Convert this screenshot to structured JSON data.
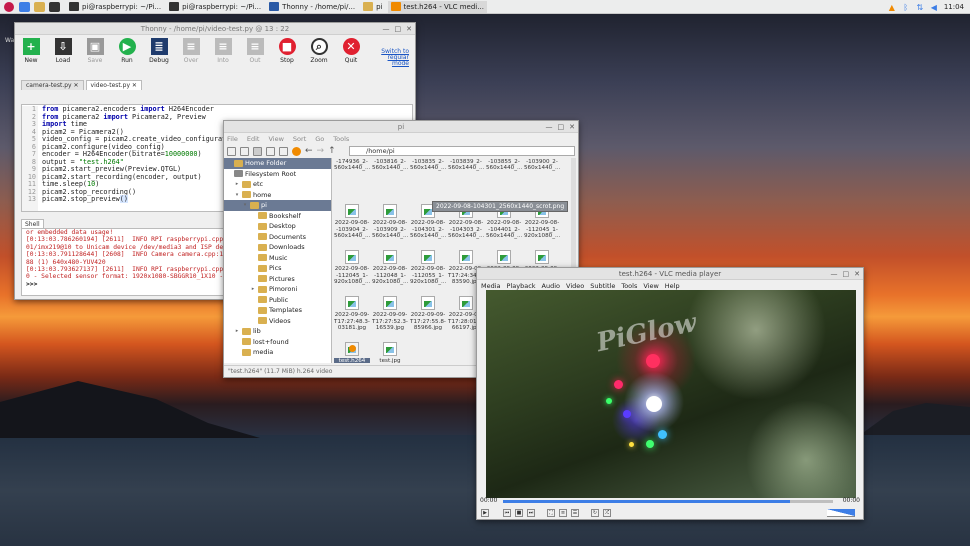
{
  "taskbar": {
    "items": [
      {
        "label": "pi@raspberrypi: ~/Pi...",
        "color": "#333"
      },
      {
        "label": "pi@raspberrypi: ~/Pi...",
        "color": "#333"
      },
      {
        "label": "Thonny - /home/pi/...",
        "color": "#2a5aa6"
      },
      {
        "label": "pi",
        "color": "#d9b050"
      },
      {
        "label": "test.h264 - VLC medi...",
        "color": "#f08a00"
      }
    ],
    "clock": "11:04"
  },
  "desktop": {
    "wastebasket": "Wa"
  },
  "thonny": {
    "title": "Thonny - /home/pi/video-test.py @ 13 : 22",
    "toolbar": [
      {
        "label": "New",
        "icon": "plus-icon",
        "color": "#23b14d",
        "enabled": true
      },
      {
        "label": "Load",
        "icon": "download-icon",
        "color": "#333",
        "enabled": true
      },
      {
        "label": "Save",
        "icon": "save-icon",
        "color": "#999",
        "enabled": false
      },
      {
        "label": "Run",
        "icon": "play-icon",
        "color": "#23b14d",
        "enabled": true
      },
      {
        "label": "Debug",
        "icon": "debug-icon",
        "color": "#1f3b6d",
        "enabled": true
      },
      {
        "label": "Over",
        "icon": "step-over-icon",
        "color": "#bbb",
        "enabled": false
      },
      {
        "label": "Into",
        "icon": "step-into-icon",
        "color": "#bbb",
        "enabled": false
      },
      {
        "label": "Out",
        "icon": "step-out-icon",
        "color": "#bbb",
        "enabled": false
      },
      {
        "label": "Stop",
        "icon": "stop-icon",
        "color": "#e02030",
        "enabled": true
      },
      {
        "label": "Zoom",
        "icon": "zoom-icon",
        "color": "#333",
        "enabled": true
      },
      {
        "label": "Quit",
        "icon": "quit-icon",
        "color": "#e02030",
        "enabled": true
      }
    ],
    "switch_mode": "Switch to regular mode",
    "tabs": [
      "camera-test.py",
      "video-test.py"
    ],
    "line_numbers": [
      "1",
      "2",
      "3",
      "4",
      "5",
      "6",
      "7",
      "8",
      "9",
      "10",
      "11",
      "12",
      "13"
    ],
    "shell_label": "Shell",
    "shell_lines": [
      "or embedded data usage!",
      "[0:13:03.786260194] [2611]  INFO RPI raspberrypi.cpp",
      "01/imx219@10 to Unicam device /dev/media3 and ISP de",
      "[0:13:03.791128644] [2608]  INFO Camera camera.cpp:1",
      "88 (1) 640x480-YUV420",
      "[0:13:03.793627137] [2611]  INFO RPI raspberrypi.cpp",
      "0 - Selected sensor format: 1920x1080-SBGGR10_1X10 -"
    ],
    "prompt": ">>>"
  },
  "fm": {
    "title": "pi",
    "menu": [
      "File",
      "Edit",
      "View",
      "Sort",
      "Go",
      "Tools"
    ],
    "path": "/home/pi",
    "sidebar": [
      {
        "label": "Home Folder",
        "indent": 0,
        "sel": true,
        "arrow": ""
      },
      {
        "label": "Filesystem Root",
        "indent": 0,
        "sel": false,
        "arrow": ""
      },
      {
        "label": "etc",
        "indent": 1,
        "sel": false,
        "arrow": "▸"
      },
      {
        "label": "home",
        "indent": 1,
        "sel": false,
        "arrow": "▾"
      },
      {
        "label": "pi",
        "indent": 2,
        "sel": true,
        "arrow": "▾"
      },
      {
        "label": "Bookshelf",
        "indent": 3,
        "sel": false,
        "arrow": ""
      },
      {
        "label": "Desktop",
        "indent": 3,
        "sel": false,
        "arrow": ""
      },
      {
        "label": "Documents",
        "indent": 3,
        "sel": false,
        "arrow": ""
      },
      {
        "label": "Downloads",
        "indent": 3,
        "sel": false,
        "arrow": ""
      },
      {
        "label": "Music",
        "indent": 3,
        "sel": false,
        "arrow": ""
      },
      {
        "label": "Pics",
        "indent": 3,
        "sel": false,
        "arrow": ""
      },
      {
        "label": "Pictures",
        "indent": 3,
        "sel": false,
        "arrow": ""
      },
      {
        "label": "Pimoroni",
        "indent": 3,
        "sel": false,
        "arrow": "▸"
      },
      {
        "label": "Public",
        "indent": 3,
        "sel": false,
        "arrow": ""
      },
      {
        "label": "Templates",
        "indent": 3,
        "sel": false,
        "arrow": ""
      },
      {
        "label": "Videos",
        "indent": 3,
        "sel": false,
        "arrow": ""
      },
      {
        "label": "lib",
        "indent": 1,
        "sel": false,
        "arrow": "▸"
      },
      {
        "label": "lost+found",
        "indent": 1,
        "sel": false,
        "arrow": ""
      },
      {
        "label": "media",
        "indent": 1,
        "sel": false,
        "arrow": ""
      }
    ],
    "files": [
      {
        "l1": "2022-09-07-",
        "l2": "-174936_2-",
        "l3": "560x1440_...",
        "kind": "label"
      },
      {
        "l1": "2022-09-08-",
        "l2": "-103816_2-",
        "l3": "560x1440_...",
        "kind": "label"
      },
      {
        "l1": "2022-09-08-",
        "l2": "-103835_2-",
        "l3": "560x1440_...",
        "kind": "label"
      },
      {
        "l1": "2022-09-08-",
        "l2": "-103839_2-",
        "l3": "560x1440_...",
        "kind": "label"
      },
      {
        "l1": "2022-09-08-",
        "l2": "-103855_2-",
        "l3": "560x1440_...",
        "kind": "label"
      },
      {
        "l1": "2022-09-08-",
        "l2": "-103900_2-",
        "l3": "560x1440_...",
        "kind": "label"
      },
      {
        "l1": "2022-09-08-",
        "l2": "-103904_2-",
        "l3": "560x1440_...",
        "kind": "img"
      },
      {
        "l1": "2022-09-08-",
        "l2": "-103909_2-",
        "l3": "560x1440_...",
        "kind": "img"
      },
      {
        "l1": "2022-09-08-",
        "l2": "-104301_2-",
        "l3": "560x1440_...",
        "kind": "img"
      },
      {
        "l1": "2022-09-08-",
        "l2": "-104303_2-",
        "l3": "560x1440_...",
        "kind": "img"
      },
      {
        "l1": "2022-09-08-",
        "l2": "-104401_2-",
        "l3": "560x1440_...",
        "kind": "img"
      },
      {
        "l1": "2022-09-08-",
        "l2": "-112045_1-",
        "l3": "920x1080_...",
        "kind": "img"
      },
      {
        "l1": "2022-09-08-",
        "l2": "-112045_1-",
        "l3": "920x1080_...",
        "kind": "img"
      },
      {
        "l1": "2022-09-08-",
        "l2": "-112048_1-",
        "l3": "920x1080_...",
        "kind": "img"
      },
      {
        "l1": "2022-09-08-",
        "l2": "-112055_1-",
        "l3": "920x1080_...",
        "kind": "img"
      },
      {
        "l1": "2022-09-09-",
        "l2": "T17:24:34.9-",
        "l3": "83590.jpg",
        "kind": "img"
      },
      {
        "l1": "2022-09-09-",
        "l2": "T17:25:59.9-",
        "l3": "",
        "kind": "img"
      },
      {
        "l1": "2022-09-09-",
        "l2": "T17:27:07.6-",
        "l3": "",
        "kind": "img"
      },
      {
        "l1": "2022-09-09-",
        "l2": "T17:27:48.3-",
        "l3": "03181.jpg",
        "kind": "img"
      },
      {
        "l1": "2022-09-09-",
        "l2": "T17:27:52.3-",
        "l3": "16539.jpg",
        "kind": "img"
      },
      {
        "l1": "2022-09-09-",
        "l2": "T17:27:55.8-",
        "l3": "85966.jpg",
        "kind": "img"
      },
      {
        "l1": "2022-09-09-",
        "l2": "T17:28:01.9-",
        "l3": "66197.jpg",
        "kind": "img"
      },
      {
        "l1": "camera-",
        "l2": "test.py",
        "l3": "",
        "kind": "py"
      },
      {
        "l1": "network1.p-",
        "l2": "ng",
        "l3": "",
        "kind": "img"
      },
      {
        "l1": "test.h264",
        "l2": "",
        "l3": "",
        "kind": "vid",
        "sel": true
      },
      {
        "l1": "test.jpg",
        "l2": "",
        "l3": "",
        "kind": "img"
      }
    ],
    "tooltip": "2022-09-08-104301_2560x1440_scrot.png",
    "status": "\"test.h264\" (11.7 MiB) h.264 video"
  },
  "vlc": {
    "title": "test.h264 - VLC media player",
    "menu": [
      "Media",
      "Playback",
      "Audio",
      "Video",
      "Subtitle",
      "Tools",
      "View",
      "Help"
    ],
    "time_elapsed": "00:00",
    "time_total": "00:00",
    "progress": 0.87,
    "volume": 0.6,
    "video_text": "PiGlow"
  }
}
